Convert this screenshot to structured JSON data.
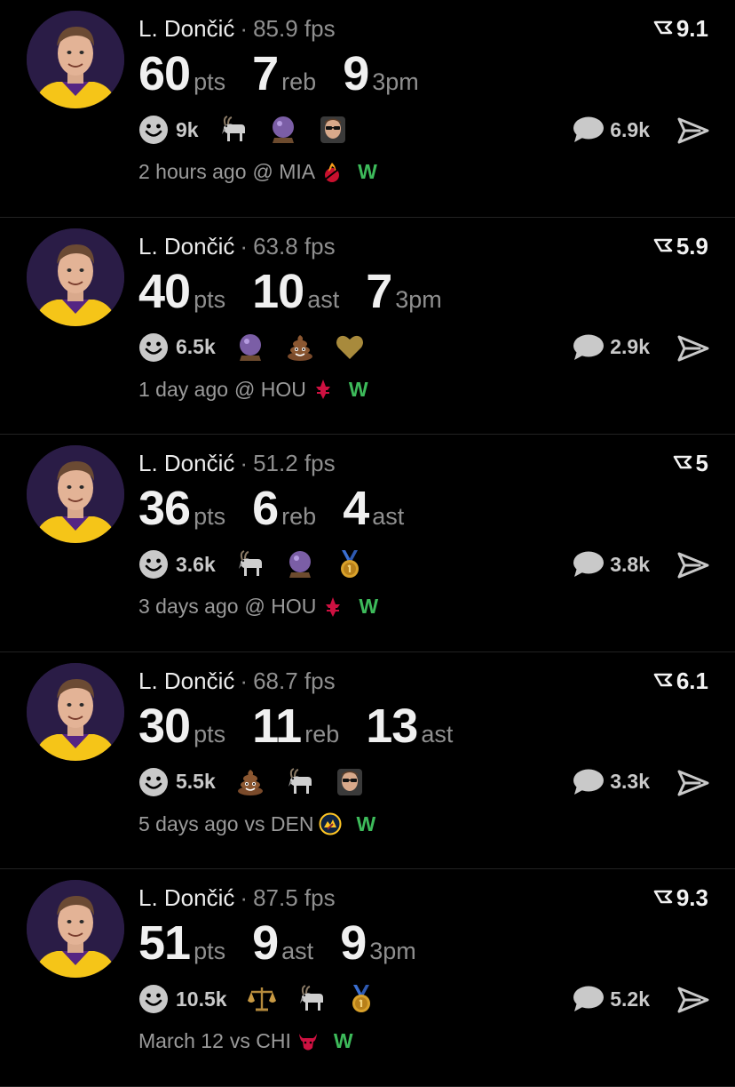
{
  "feed": [
    {
      "player": "L. Dončić",
      "fps": "85.9 fps",
      "rating": "9.1",
      "stats": [
        {
          "value": "60",
          "unit": "pts"
        },
        {
          "value": "7",
          "unit": "reb"
        },
        {
          "value": "9",
          "unit": "3pm"
        }
      ],
      "reactions_count": "9k",
      "emojis": [
        "goat-emoji",
        "crystal-ball-emoji",
        "sunglasses-player-emoji"
      ],
      "comments": "6.9k",
      "time": "2 hours ago",
      "venue": "@ MIA",
      "team_logo": "heat-logo",
      "result": "W"
    },
    {
      "player": "L. Dončić",
      "fps": "63.8 fps",
      "rating": "5.9",
      "stats": [
        {
          "value": "40",
          "unit": "pts"
        },
        {
          "value": "10",
          "unit": "ast"
        },
        {
          "value": "7",
          "unit": "3pm"
        }
      ],
      "reactions_count": "6.5k",
      "emojis": [
        "crystal-ball-emoji",
        "poop-emoji",
        "gold-heart-emoji"
      ],
      "comments": "2.9k",
      "time": "1 day ago",
      "venue": "@ HOU",
      "team_logo": "rockets-logo",
      "result": "W"
    },
    {
      "player": "L. Dončić",
      "fps": "51.2 fps",
      "rating": "5",
      "stats": [
        {
          "value": "36",
          "unit": "pts"
        },
        {
          "value": "6",
          "unit": "reb"
        },
        {
          "value": "4",
          "unit": "ast"
        }
      ],
      "reactions_count": "3.6k",
      "emojis": [
        "goat-emoji",
        "crystal-ball-emoji",
        "medal-emoji"
      ],
      "comments": "3.8k",
      "time": "3 days ago",
      "venue": "@ HOU",
      "team_logo": "rockets-logo",
      "result": "W"
    },
    {
      "player": "L. Dončić",
      "fps": "68.7 fps",
      "rating": "6.1",
      "stats": [
        {
          "value": "30",
          "unit": "pts"
        },
        {
          "value": "11",
          "unit": "reb"
        },
        {
          "value": "13",
          "unit": "ast"
        }
      ],
      "reactions_count": "5.5k",
      "emojis": [
        "poop-emoji",
        "goat-emoji",
        "sunglasses-player-emoji"
      ],
      "comments": "3.3k",
      "time": "5 days ago",
      "venue": "vs DEN",
      "team_logo": "nuggets-logo",
      "result": "W"
    },
    {
      "player": "L. Dončić",
      "fps": "87.5 fps",
      "rating": "9.3",
      "stats": [
        {
          "value": "51",
          "unit": "pts"
        },
        {
          "value": "9",
          "unit": "ast"
        },
        {
          "value": "9",
          "unit": "3pm"
        }
      ],
      "reactions_count": "10.5k",
      "emojis": [
        "scales-emoji",
        "goat-emoji",
        "medal-emoji"
      ],
      "comments": "5.2k",
      "time": "March 12",
      "venue": "vs CHI",
      "team_logo": "bulls-logo",
      "result": "W"
    }
  ],
  "colors": {
    "background": "#000000",
    "win": "#3dba5a",
    "muted": "#8f8f8f",
    "avatar_bg": "#2a1c46",
    "jersey": "#f5c518"
  }
}
